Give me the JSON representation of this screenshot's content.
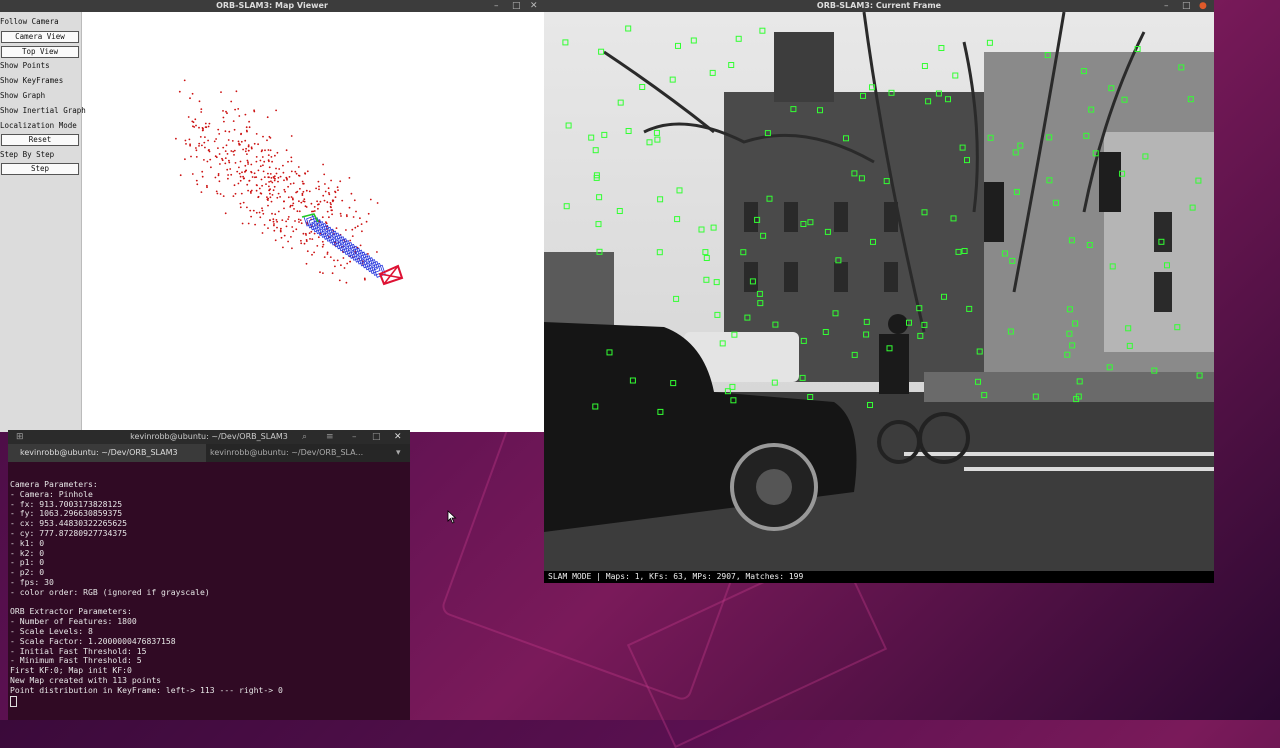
{
  "desktop": {
    "accent": "#7a1a5a"
  },
  "map_viewer": {
    "title": "ORB-SLAM3: Map Viewer",
    "panel": {
      "follow_camera": "Follow Camera",
      "camera_view": "Camera View",
      "top_view": "Top View",
      "show_points": "Show Points",
      "show_keyframes": "Show KeyFrames",
      "show_graph": "Show Graph",
      "show_inertial_graph": "Show Inertial Graph",
      "localization_mode": "Localization Mode",
      "reset": "Reset",
      "step_by_step": "Step By Step",
      "step": "Step"
    },
    "colors": {
      "map_points": "#cc1111",
      "keyframes": "#2233dd",
      "current_camera": "#dd1133",
      "graph": "#22cc22"
    }
  },
  "current_frame": {
    "title": "ORB-SLAM3: Current Frame",
    "status": "SLAM MODE |  Maps: 1, KFs: 63, MPs: 2907, Matches: 199",
    "feature_color": "#33ff33"
  },
  "terminal": {
    "title": "kevinrobb@ubuntu: ~/Dev/ORB_SLAM3",
    "tab1": "kevinrobb@ubuntu: ~/Dev/ORB_SLAM3",
    "tab2": "kevinrobb@ubuntu: ~/Dev/ORB_SLA...",
    "lines": [
      "Camera Parameters:",
      "- Camera: Pinhole",
      "- fx: 913.7003173828125",
      "- fy: 1063.296630859375",
      "- cx: 953.44830322265625",
      "- cy: 777.87280927734375",
      "- k1: 0",
      "- k2: 0",
      "- p1: 0",
      "- p2: 0",
      "- fps: 30",
      "- color order: RGB (ignored if grayscale)",
      "",
      "ORB Extractor Parameters:",
      "- Number of Features: 1800",
      "- Scale Levels: 8",
      "- Scale Factor: 1.2000000476837158",
      "- Initial Fast Threshold: 15",
      "- Minimum Fast Threshold: 5",
      "First KF:0; Map init KF:0",
      "New Map created with 113 points",
      "Point distribution in KeyFrame: left-> 113 --- right-> 0"
    ]
  }
}
